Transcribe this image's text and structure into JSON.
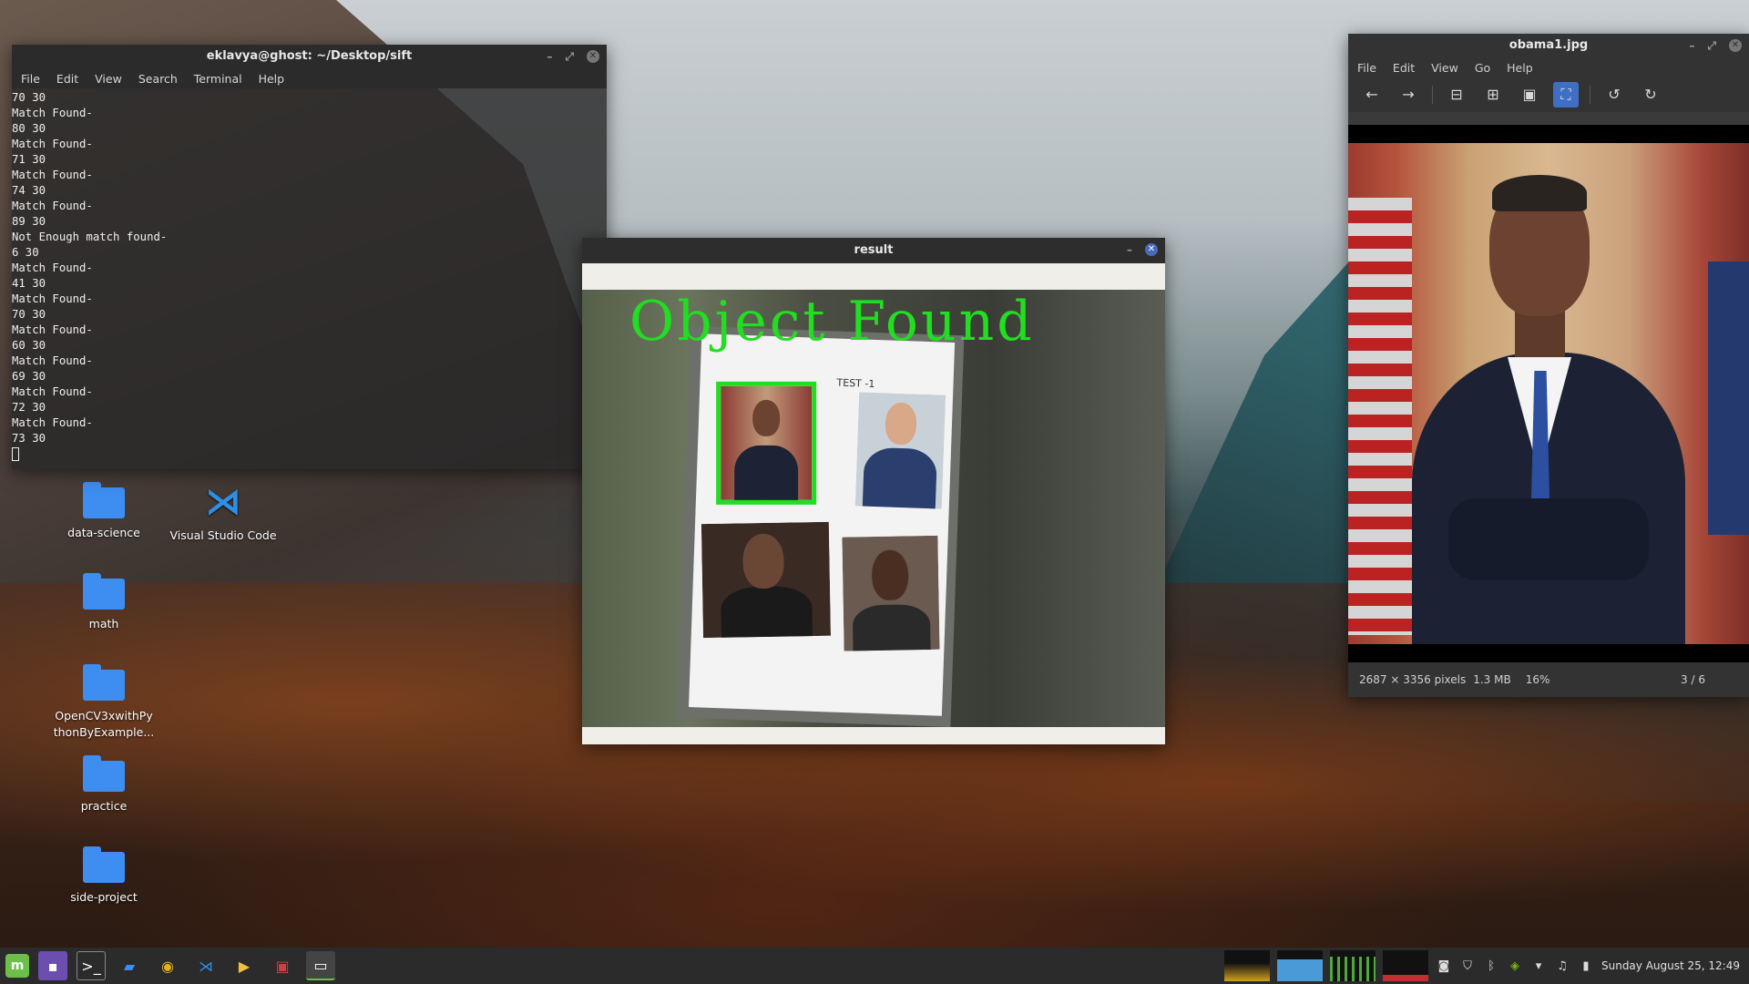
{
  "desktop": {
    "icons": [
      {
        "label": "data-science",
        "type": "folder"
      },
      {
        "label": "Visual Studio Code",
        "type": "app"
      },
      {
        "label": "math",
        "type": "folder"
      },
      {
        "label": "OpenCV3xwithPythonByExample...",
        "type": "folder"
      },
      {
        "label": "practice",
        "type": "folder"
      },
      {
        "label": "side-project",
        "type": "folder"
      }
    ]
  },
  "terminal": {
    "title": "eklavya@ghost: ~/Desktop/sift",
    "menu": [
      "File",
      "Edit",
      "View",
      "Search",
      "Terminal",
      "Help"
    ],
    "output": "70 30\nMatch Found-\n80 30\nMatch Found-\n71 30\nMatch Found-\n74 30\nMatch Found-\n89 30\nNot Enough match found-\n6 30\nMatch Found-\n41 30\nMatch Found-\n70 30\nMatch Found-\n60 30\nMatch Found-\n69 30\nMatch Found-\n72 30\nMatch Found-\n73 30"
  },
  "result": {
    "title": "result",
    "overlay_text": "Object Found",
    "sheet_label": "TEST -1",
    "highlight_color": "#22dd22"
  },
  "viewer": {
    "title": "obama1.jpg",
    "menu": [
      "File",
      "Edit",
      "View",
      "Go",
      "Help"
    ],
    "status": {
      "dimensions": "2687 × 3356 pixels",
      "size": "1.3 MB",
      "zoom": "16%",
      "position": "3 / 6"
    }
  },
  "taskbar": {
    "clock": "Sunday August 25, 12:49",
    "accent": "#6cc04a"
  }
}
